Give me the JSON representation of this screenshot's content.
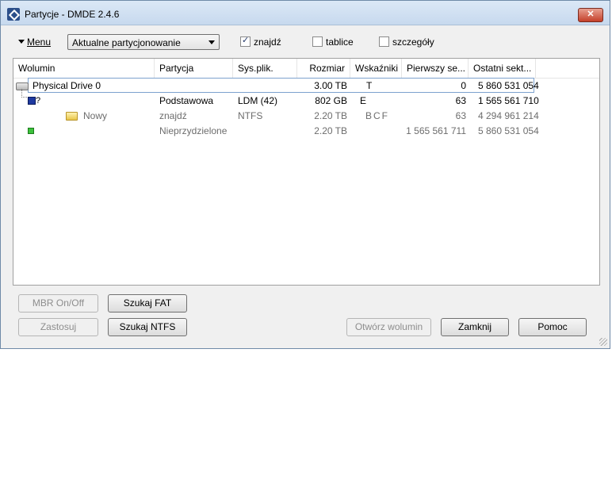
{
  "window": {
    "title": "Partycje - DMDE 2.4.6",
    "close_label": "✕"
  },
  "toolbar": {
    "menu_label": "Menu",
    "partitioning_select": "Aktualne partycjonowanie",
    "checkbox_find": {
      "label": "znajdź",
      "checked": true
    },
    "checkbox_tables": {
      "label": "tablice",
      "checked": false
    },
    "checkbox_details": {
      "label": "szczegóły",
      "checked": false
    }
  },
  "table": {
    "columns": [
      "Wolumin",
      "Partycja",
      "Sys.plik.",
      "Rozmiar",
      "Wskaźniki",
      "Pierwszy se...",
      "Ostatni sekt..."
    ],
    "rows": [
      {
        "volume": "Physical Drive 0",
        "partition": "",
        "fs": "",
        "size": "3.00 TB",
        "flags": "T",
        "first": "0",
        "last": "5 860 531 054",
        "icon": "drive-icon",
        "style": "normal"
      },
      {
        "volume": "?",
        "partition": "Podstawowa",
        "fs": "LDM (42)",
        "size": "802 GB",
        "flags": "E",
        "first": "63",
        "last": "1 565 561 710",
        "icon": "partition-icon",
        "style": "normal"
      },
      {
        "volume": "Nowy",
        "partition": "znajdź",
        "fs": "NTFS",
        "size": "2.20 TB",
        "flags": "BCF",
        "first": "63",
        "last": "4 294 961 214",
        "icon": "folder-icon",
        "style": "grey"
      },
      {
        "volume": "",
        "partition": "Nieprzydzielone",
        "fs": "",
        "size": "2.20 TB",
        "flags": "",
        "first": "1 565 561 711",
        "last": "5 860 531 054",
        "icon": "free-space-icon",
        "style": "grey"
      }
    ]
  },
  "buttons": {
    "mbr": "MBR On/Off",
    "search_fat": "Szukaj FAT",
    "apply": "Zastosuj",
    "search_ntfs": "Szukaj NTFS",
    "open_volume": "Otwórz wolumin",
    "close": "Zamknij",
    "help": "Pomoc"
  }
}
